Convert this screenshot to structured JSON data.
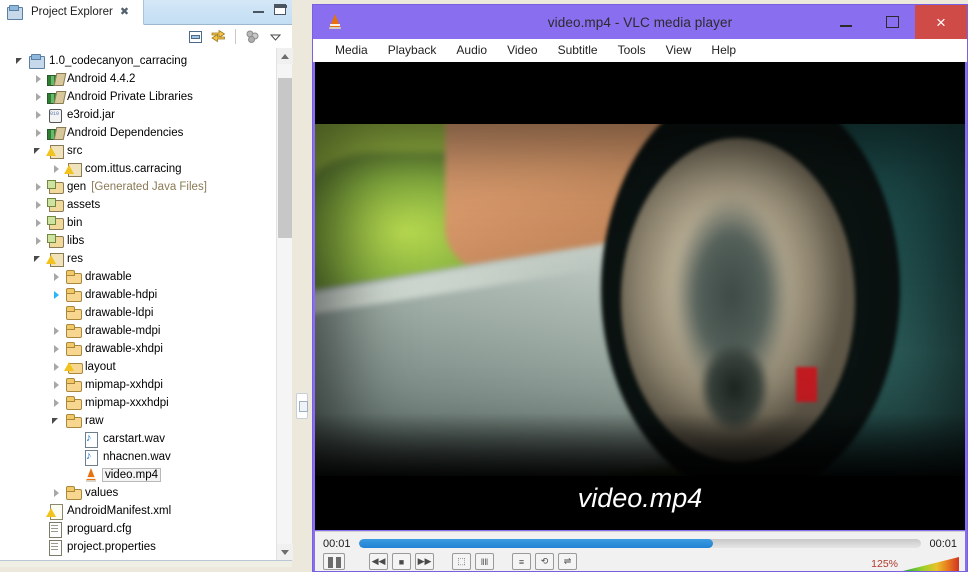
{
  "eclipse": {
    "tab": {
      "title": "Project Explorer",
      "icon": "project-explorer-icon",
      "close": "✖"
    },
    "window_buttons": {
      "minimize": "minimize",
      "maximize": "maximize"
    },
    "toolbar": [
      {
        "name": "collapse-all-icon",
        "label": "Collapse All"
      },
      {
        "name": "link-with-editor-icon",
        "label": "Link with Editor"
      },
      {
        "name": "focus-on-active-task-icon",
        "label": "Focus on Active Task"
      },
      {
        "name": "view-menu-icon",
        "label": "View Menu"
      }
    ],
    "tree": [
      {
        "label": "1.0_codecanyon_carracing",
        "indent": 0,
        "arrow": "open",
        "icon": "android-project-icon",
        "selected": false,
        "suffix": ""
      },
      {
        "label": "Android 4.4.2",
        "indent": 1,
        "arrow": "closed",
        "icon": "library-icon",
        "selected": false,
        "suffix": ""
      },
      {
        "label": "Android Private Libraries",
        "indent": 1,
        "arrow": "closed",
        "icon": "library-icon",
        "selected": false,
        "suffix": ""
      },
      {
        "label": "e3roid.jar",
        "indent": 1,
        "arrow": "closed",
        "icon": "jar-icon",
        "selected": false,
        "suffix": ""
      },
      {
        "label": "Android Dependencies",
        "indent": 1,
        "arrow": "closed",
        "icon": "library-icon",
        "selected": false,
        "suffix": ""
      },
      {
        "label": "src",
        "indent": 1,
        "arrow": "open",
        "icon": "source-folder-warning-icon",
        "selected": false,
        "suffix": ""
      },
      {
        "label": "com.ittus.carracing",
        "indent": 2,
        "arrow": "closed",
        "icon": "package-warning-icon",
        "selected": false,
        "suffix": ""
      },
      {
        "label": "gen",
        "indent": 1,
        "arrow": "closed",
        "icon": "generated-folder-icon",
        "selected": false,
        "suffix": "[Generated Java Files]"
      },
      {
        "label": "assets",
        "indent": 1,
        "arrow": "closed",
        "icon": "source-folder-icon",
        "selected": false,
        "suffix": ""
      },
      {
        "label": "bin",
        "indent": 1,
        "arrow": "closed",
        "icon": "source-folder-icon",
        "selected": false,
        "suffix": ""
      },
      {
        "label": "libs",
        "indent": 1,
        "arrow": "closed",
        "icon": "source-folder-icon",
        "selected": false,
        "suffix": ""
      },
      {
        "label": "res",
        "indent": 1,
        "arrow": "open",
        "icon": "source-folder-warning-icon",
        "selected": false,
        "suffix": ""
      },
      {
        "label": "drawable",
        "indent": 2,
        "arrow": "closed",
        "icon": "folder-icon",
        "selected": false,
        "suffix": ""
      },
      {
        "label": "drawable-hdpi",
        "indent": 2,
        "arrow": "closed-highlight",
        "icon": "folder-icon",
        "selected": false,
        "suffix": ""
      },
      {
        "label": "drawable-ldpi",
        "indent": 2,
        "arrow": "none",
        "icon": "folder-icon",
        "selected": false,
        "suffix": ""
      },
      {
        "label": "drawable-mdpi",
        "indent": 2,
        "arrow": "closed",
        "icon": "folder-icon",
        "selected": false,
        "suffix": ""
      },
      {
        "label": "drawable-xhdpi",
        "indent": 2,
        "arrow": "closed",
        "icon": "folder-icon",
        "selected": false,
        "suffix": ""
      },
      {
        "label": "layout",
        "indent": 2,
        "arrow": "closed",
        "icon": "folder-warning-icon",
        "selected": false,
        "suffix": ""
      },
      {
        "label": "mipmap-xxhdpi",
        "indent": 2,
        "arrow": "closed",
        "icon": "folder-icon",
        "selected": false,
        "suffix": ""
      },
      {
        "label": "mipmap-xxxhdpi",
        "indent": 2,
        "arrow": "closed",
        "icon": "folder-icon",
        "selected": false,
        "suffix": ""
      },
      {
        "label": "raw",
        "indent": 2,
        "arrow": "open",
        "icon": "folder-icon",
        "selected": false,
        "suffix": ""
      },
      {
        "label": "carstart.wav",
        "indent": 3,
        "arrow": "none",
        "icon": "wav-file-icon",
        "selected": false,
        "suffix": ""
      },
      {
        "label": "nhacnen.wav",
        "indent": 3,
        "arrow": "none",
        "icon": "wav-file-icon",
        "selected": false,
        "suffix": ""
      },
      {
        "label": "video.mp4",
        "indent": 3,
        "arrow": "none",
        "icon": "vlc-file-icon",
        "selected": true,
        "suffix": ""
      },
      {
        "label": "values",
        "indent": 2,
        "arrow": "closed",
        "icon": "folder-icon",
        "selected": false,
        "suffix": ""
      },
      {
        "label": "AndroidManifest.xml",
        "indent": 1,
        "arrow": "none",
        "icon": "xml-warning-icon",
        "selected": false,
        "suffix": ""
      },
      {
        "label": "proguard.cfg",
        "indent": 1,
        "arrow": "none",
        "icon": "file-icon",
        "selected": false,
        "suffix": ""
      },
      {
        "label": "project.properties",
        "indent": 1,
        "arrow": "none",
        "icon": "file-icon",
        "selected": false,
        "suffix": ""
      }
    ]
  },
  "vlc": {
    "title": "video.mp4 - VLC media player",
    "title_icon": "vlc-cone-icon",
    "accent_titlebar": "#8a6ef0",
    "close_color": "#cf4b47",
    "window_buttons": {
      "minimize": "minimize",
      "maximize": "maximize",
      "close": "×"
    },
    "menus": [
      {
        "label": "Media"
      },
      {
        "label": "Playback"
      },
      {
        "label": "Audio"
      },
      {
        "label": "Video"
      },
      {
        "label": "Subtitle"
      },
      {
        "label": "Tools"
      },
      {
        "label": "View"
      },
      {
        "label": "Help"
      }
    ],
    "osd_title": "video.mp4",
    "playback": {
      "elapsed": "00:01",
      "remaining": "00:01",
      "progress_percent": 63
    },
    "controls": [
      {
        "name": "play-pause-button",
        "glyph": "▐▌"
      },
      {
        "name": "previous-button",
        "glyph": "◀◀"
      },
      {
        "name": "stop-button",
        "glyph": "■"
      },
      {
        "name": "next-button",
        "glyph": "▶▶"
      },
      {
        "name": "fullscreen-button",
        "glyph": "⬚"
      },
      {
        "name": "extended-settings-button",
        "glyph": "‖‖"
      },
      {
        "name": "playlist-button",
        "glyph": "≡"
      },
      {
        "name": "loop-button",
        "glyph": "⟲"
      },
      {
        "name": "random-button",
        "glyph": "⇌"
      }
    ],
    "volume": {
      "value": "125%",
      "name": "volume-slider"
    }
  }
}
